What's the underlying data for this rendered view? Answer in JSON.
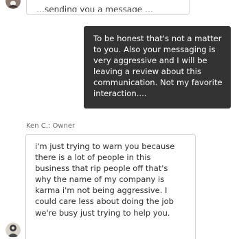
{
  "thread": {
    "previous_message_fragment": "…sending you a message …",
    "reply": {
      "lines": [
        "To be honest that's not a matter",
        "to you. Also your messaging is",
        "very aggressive and I will be",
        "leaving a review about this",
        "communication. Not my favorite",
        "interaction...."
      ]
    },
    "business_reply": {
      "sender": "Ken C.: Owner",
      "lines": [
        "i'm just trying to warn you because",
        "there is a lot of people in this",
        "business that rip people off that's",
        "why the name of my company is",
        "karma  i'm not being aggressive. I",
        "could care less about doing the job",
        "we're busy just trying to help you."
      ]
    }
  },
  "icons": {
    "top_avatar": "user-avatar-icon",
    "bottom_avatar": "business-avatar-icon"
  },
  "colors": {
    "outgoing_bubble": "#333333",
    "incoming_border": "#d3d3d3"
  }
}
